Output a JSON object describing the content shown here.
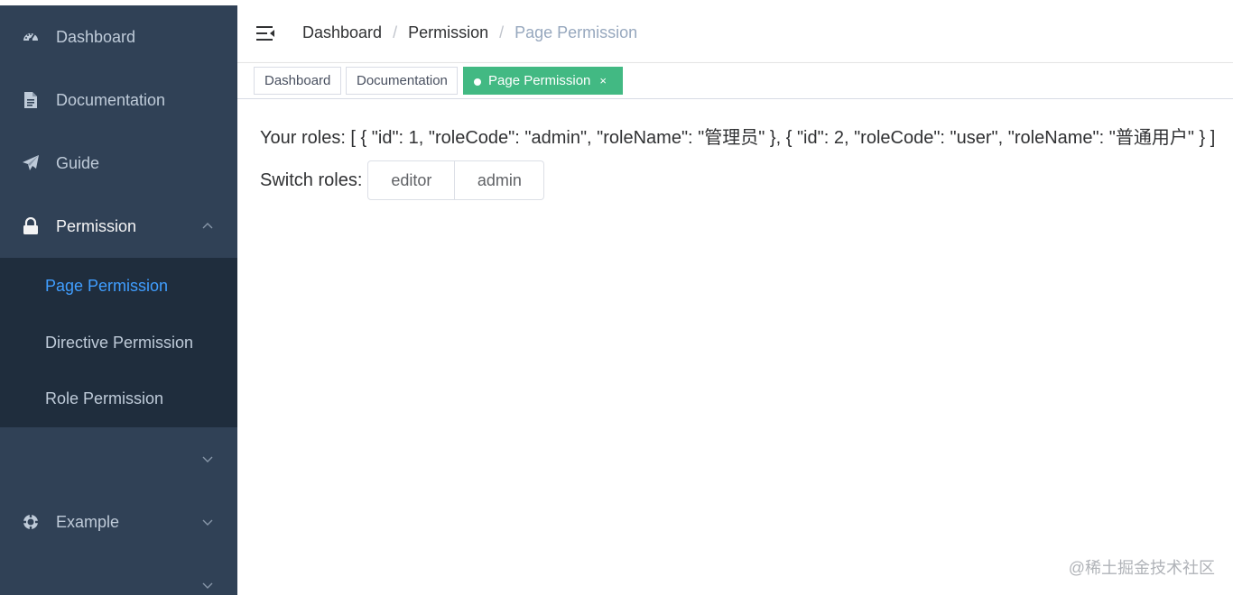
{
  "sidebar": {
    "items": [
      {
        "label": "Dashboard",
        "icon": "dashboard-icon"
      },
      {
        "label": "Documentation",
        "icon": "document-icon"
      },
      {
        "label": "Guide",
        "icon": "paper-plane-icon"
      },
      {
        "label": "Permission",
        "icon": "lock-icon"
      },
      {
        "label": "Example",
        "icon": "example-icon"
      }
    ],
    "submenu": [
      {
        "label": "Page Permission",
        "active": true
      },
      {
        "label": "Directive Permission"
      },
      {
        "label": "Role Permission"
      }
    ]
  },
  "breadcrumb": [
    "Dashboard",
    "Permission",
    "Page Permission"
  ],
  "breadcrumb_separator": "/",
  "tags": [
    {
      "label": "Dashboard"
    },
    {
      "label": "Documentation"
    },
    {
      "label": "Page Permission",
      "active": true,
      "close": "×"
    }
  ],
  "main": {
    "roles_text": "Your roles: [ { \"id\": 1, \"roleCode\": \"admin\", \"roleName\": \"管理员\" }, { \"id\": 2, \"roleCode\": \"user\", \"roleName\": \"普通用户\" } ]",
    "switch_label": "Switch roles:",
    "role_options": [
      "editor",
      "admin"
    ]
  },
  "watermark": "@稀土掘金技术社区",
  "colors": {
    "sidebar_bg": "#304156",
    "submenu_bg": "#1f2d3d",
    "active_text": "#409eff",
    "active_tag": "#42b983"
  }
}
